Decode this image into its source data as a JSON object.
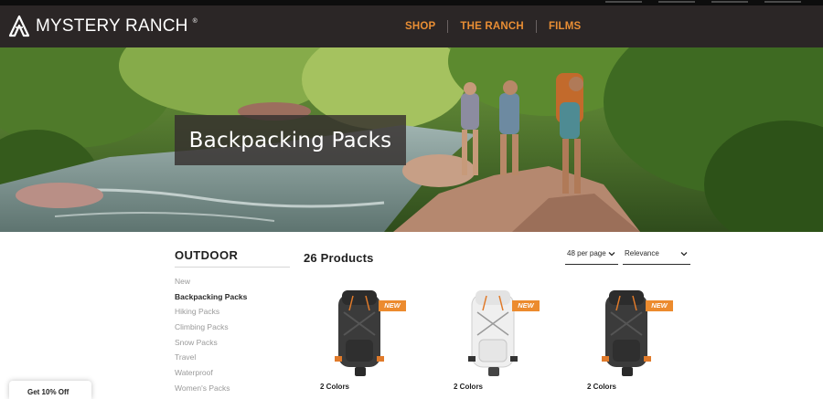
{
  "header": {
    "brand": "MYSTERY RANCH",
    "nav": [
      "SHOP",
      "THE RANCH",
      "FILMS"
    ],
    "accent_color": "#e98e34",
    "background_color": "#2b2626"
  },
  "hero": {
    "title": "Backpacking Packs",
    "image_description_icon": "hikers-by-river-photo"
  },
  "sidebar": {
    "title": "OUTDOOR",
    "items": [
      "New",
      "Backpacking Packs",
      "Hiking Packs",
      "Climbing Packs",
      "Snow Packs",
      "Travel",
      "Waterproof",
      "Women's Packs"
    ],
    "active_index": 1
  },
  "listing": {
    "count_label": "26 Products",
    "per_page": "48 per page",
    "sort": "Relevance",
    "products": [
      {
        "badge": "NEW",
        "colors": "2 Colors",
        "pack_color": "#3b3b3b",
        "accent": "#e07a2a"
      },
      {
        "badge": "NEW",
        "colors": "2 Colors",
        "pack_color": "#f2f2f2",
        "accent": "#e07a2a"
      },
      {
        "badge": "NEW",
        "colors": "2 Colors",
        "pack_color": "#3b3b3b",
        "accent": "#e07a2a"
      }
    ]
  },
  "promo": {
    "label": "Get 10% Off"
  }
}
